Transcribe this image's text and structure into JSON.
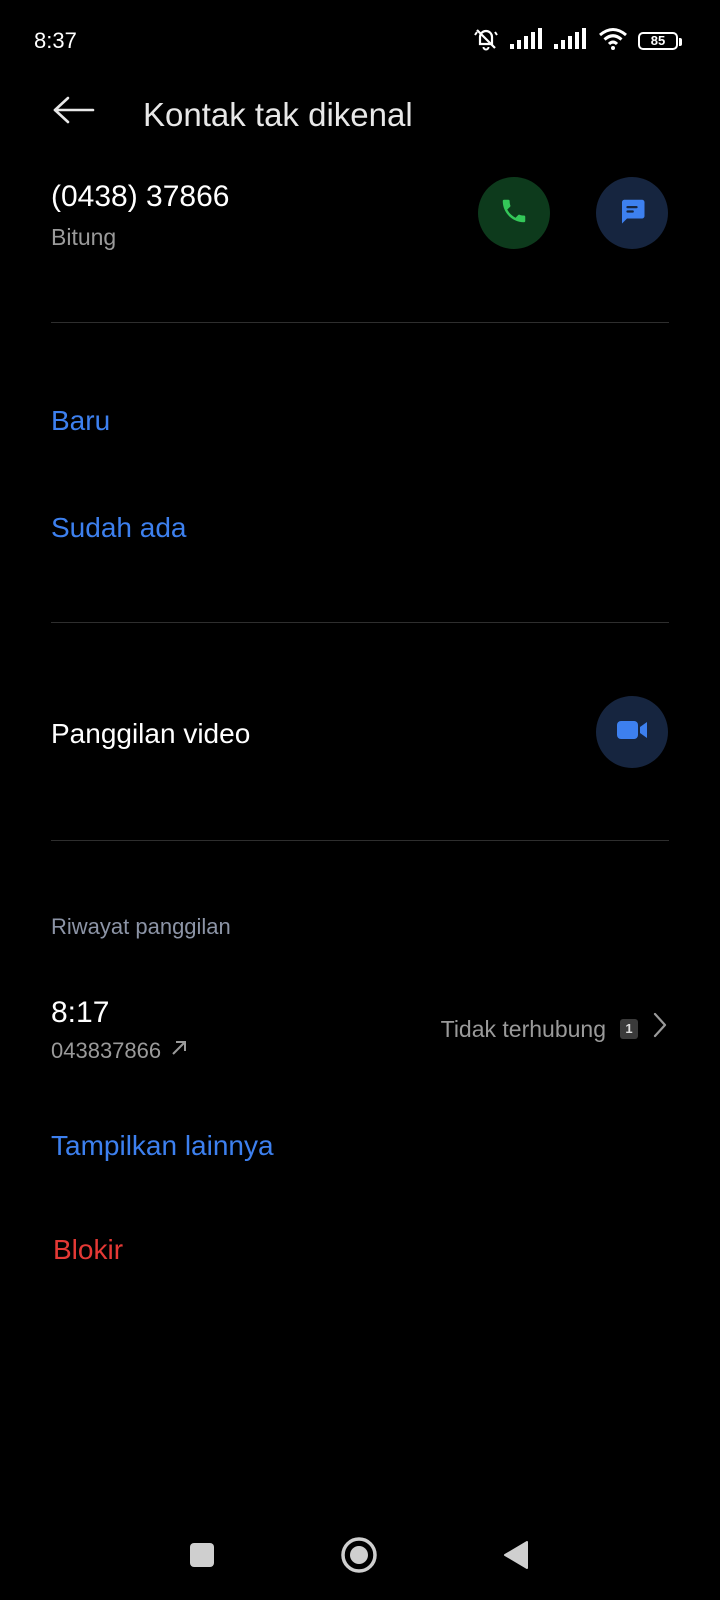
{
  "status_bar": {
    "time": "8:37",
    "battery": "85"
  },
  "header": {
    "title": "Kontak tak dikenal"
  },
  "contact": {
    "phone": "(0438) 37866",
    "location": "Bitung"
  },
  "add_contact": {
    "new_label": "Baru",
    "existing_label": "Sudah ada"
  },
  "video_call": {
    "label": "Panggilan video"
  },
  "call_history": {
    "header": "Riwayat panggilan",
    "entries": [
      {
        "time": "8:17",
        "number": "043837866",
        "status": "Tidak terhubung",
        "sim": "1"
      }
    ],
    "show_more_label": "Tampilkan lainnya"
  },
  "block": {
    "label": "Blokir"
  },
  "colors": {
    "accent_blue": "#3d80ef",
    "danger_red": "#e53935",
    "call_green": "#34c759",
    "background": "#000000"
  },
  "icons": {
    "back": "arrow-left-icon",
    "call": "phone-icon",
    "message": "message-icon",
    "video": "video-camera-icon",
    "outgoing": "outgoing-arrow-icon",
    "chevron": "chevron-right-icon"
  }
}
